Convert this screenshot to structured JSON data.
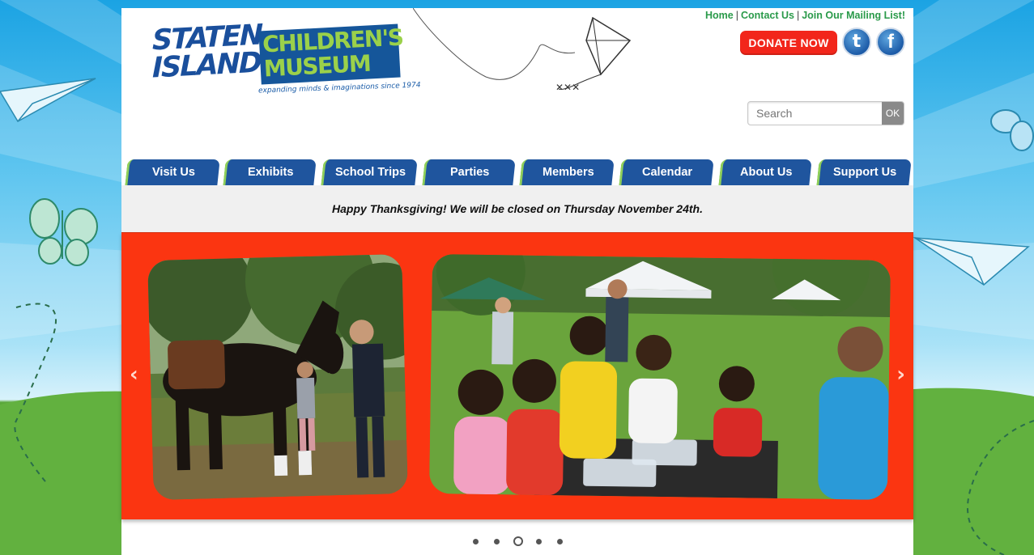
{
  "logo": {
    "line1": "STATEN",
    "line2": "ISLAND",
    "line3": "CHILDREN'S",
    "line4": "MUSEUM",
    "tagline": "expanding minds & imaginations since 1974"
  },
  "top_links": {
    "home": "Home",
    "contact": "Contact Us",
    "mailing": "Join Our Mailing List!",
    "separator": "|"
  },
  "donate_label": "DONATE NOW",
  "social": {
    "twitter_glyph": "t",
    "facebook_glyph": "f",
    "twitter_icon": "twitter-icon",
    "facebook_icon": "facebook-icon"
  },
  "search": {
    "placeholder": "Search",
    "button_label": "OK"
  },
  "nav": {
    "items": [
      {
        "label": "Visit Us"
      },
      {
        "label": "Exhibits"
      },
      {
        "label": "School Trips"
      },
      {
        "label": "Parties"
      },
      {
        "label": "Members"
      },
      {
        "label": "Calendar"
      },
      {
        "label": "About Us"
      },
      {
        "label": "Support Us"
      }
    ]
  },
  "announcement": "Happy Thanksgiving!  We will be closed on Thursday November 24th.",
  "slider": {
    "prev_glyph": "‹",
    "next_glyph": "›",
    "dot_count": 5,
    "active_index": 2
  },
  "colors": {
    "brand_blue": "#1f559e",
    "accent_green": "#8fcf5a",
    "slider_red": "#fb3511",
    "donate_red": "#f2261b",
    "link_green": "#2a9a4a"
  }
}
